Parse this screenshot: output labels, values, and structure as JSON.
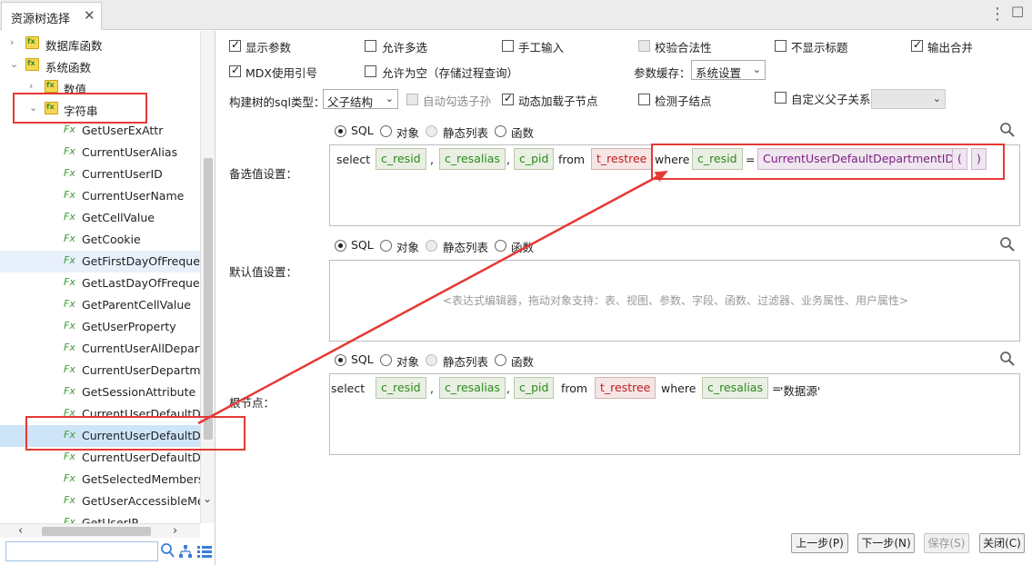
{
  "window": {
    "tab_title": "资源树选择",
    "close_glyph": "✕",
    "menu_glyph": "⋮",
    "minimize_glyph": "☐"
  },
  "tree": {
    "nodes": [
      {
        "label": "数据库函数",
        "type": "folder",
        "level": 0,
        "expanded": false
      },
      {
        "label": "系统函数",
        "type": "folder",
        "level": 0,
        "expanded": true
      },
      {
        "label": "数值",
        "type": "folder",
        "level": 1,
        "expanded": false
      },
      {
        "label": "字符串",
        "type": "folder",
        "level": 1,
        "expanded": true
      },
      {
        "label": "GetUserExAttr",
        "type": "func"
      },
      {
        "label": "CurrentUserAlias",
        "type": "func"
      },
      {
        "label": "CurrentUserID",
        "type": "func"
      },
      {
        "label": "CurrentUserName",
        "type": "func"
      },
      {
        "label": "GetCellValue",
        "type": "func"
      },
      {
        "label": "GetCookie",
        "type": "func"
      },
      {
        "label": "GetFirstDayOfFrequen",
        "type": "func"
      },
      {
        "label": "GetLastDayOfFrequenc",
        "type": "func"
      },
      {
        "label": "GetParentCellValue",
        "type": "func"
      },
      {
        "label": "GetUserProperty",
        "type": "func"
      },
      {
        "label": "CurrentUserAllDepartr",
        "type": "func"
      },
      {
        "label": "CurrentUserDepartmer",
        "type": "func"
      },
      {
        "label": "GetSessionAttribute",
        "type": "func"
      },
      {
        "label": "CurrentUserDefaultDe",
        "type": "func"
      },
      {
        "label": "CurrentUserDefaultDe",
        "type": "func"
      },
      {
        "label": "CurrentUserDefaultDe",
        "type": "func"
      },
      {
        "label": "GetSelectedMembers",
        "type": "func"
      },
      {
        "label": "GetUserAccessibleMer",
        "type": "func"
      },
      {
        "label": "GetUserIP",
        "type": "func"
      }
    ],
    "fx_glyph": "Fx",
    "search_placeholder": ""
  },
  "options": {
    "show_params": "显示参数",
    "allow_multi": "允许多选",
    "manual_input": "手工输入",
    "validate": "校验合法性",
    "hide_title": "不显示标题",
    "output_merge": "输出合并",
    "mdx_quote": "MDX使用引号",
    "allow_empty": "允许为空（存储过程查询）",
    "param_cache_label": "参数缓存：",
    "param_cache_value": "系统设置",
    "sql_type_label": "构建树的sql类型：",
    "sql_type_value": "父子结构",
    "auto_check_children": "自动勾选子孙",
    "dynamic_load": "动态加载子节点",
    "detect_children": "检测子结点",
    "custom_parent_child": "自定义父子关系",
    "custom_value": ""
  },
  "sections": {
    "candidate_label": "备选值设置：",
    "default_label": "默认值设置：",
    "root_label": "根节点：",
    "modes": [
      "SQL",
      "对象",
      "静态列表",
      "函数"
    ],
    "placeholder": "<表达式编辑器，拖动对象支持：表、视图、参数、字段、函数、过滤器、业务属性、用户属性>"
  },
  "sql": {
    "select": "select",
    "from": "from",
    "where": "where",
    "comma": ",",
    "eq": "=",
    "c_resid": "c_resid",
    "c_resalias": "c_resalias",
    "c_pid": "c_pid",
    "t_restree": "t_restree",
    "func_name": "CurrentUserDefaultDepartmentID",
    "lparen": "(",
    "rparen": ")",
    "root_value": "'数据源'"
  },
  "buttons": {
    "prev": "上一步(P)",
    "next": "下一步(N)",
    "save": "保存(S)",
    "close": "关闭(C)"
  },
  "annotation_color": "#e53935"
}
